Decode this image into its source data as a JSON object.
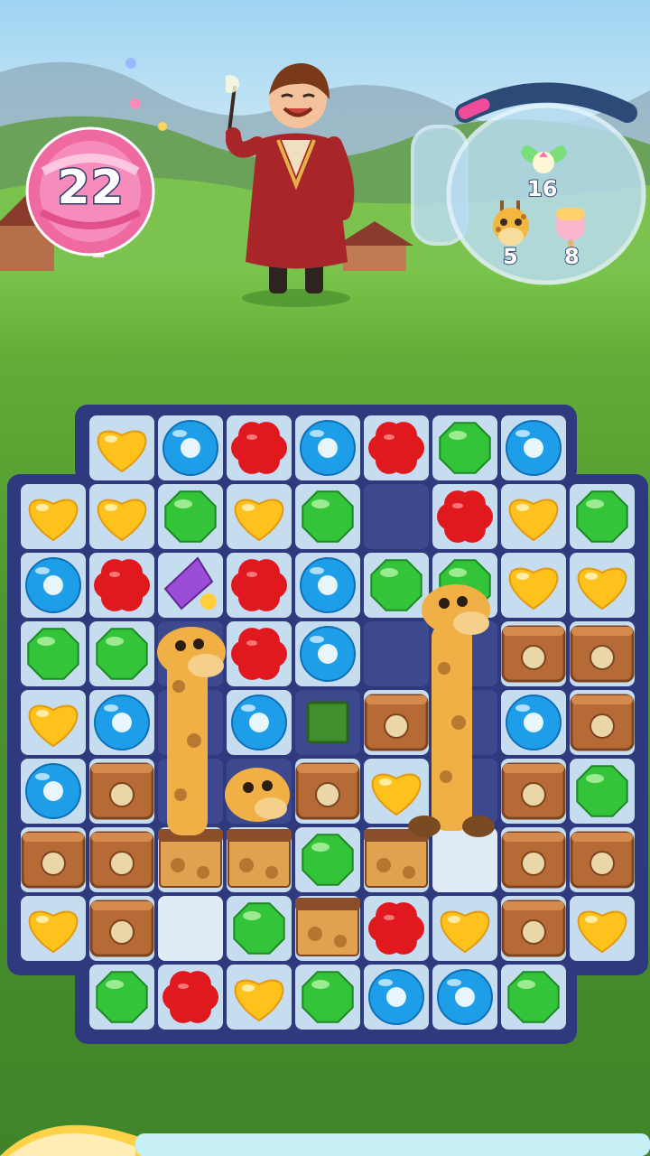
{
  "hud": {
    "moves_left": "22",
    "goals": [
      {
        "icon": "fairy-icon",
        "count": "16"
      },
      {
        "icon": "giraffe-icon",
        "count": "5"
      },
      {
        "icon": "popsicle-icon",
        "count": "8"
      }
    ],
    "progress": 0.12
  },
  "colors": {
    "red": "#e0191f",
    "blue": "#1e9ee8",
    "green": "#33c43a",
    "yellow": "#ffc21d",
    "board": "#2e3a7d",
    "crate": "#b66b36",
    "cellLight": "#cfe6f6"
  },
  "board": {
    "rows": [
      [
        "void",
        "void",
        "yellow-heart",
        "blue-ring",
        "red-flower",
        "blue-ring",
        "red-flower",
        "green-gem",
        "blue-ring",
        "void"
      ],
      [
        "void",
        "yellow-heart",
        "yellow-heart",
        "green-gem",
        "yellow-heart",
        "green-gem",
        "empty",
        "red-flower",
        "yellow-heart",
        "green-gem"
      ],
      [
        "void",
        "blue-ring",
        "red-flower",
        "rocket",
        "red-flower",
        "blue-ring",
        "green-gem",
        "green-gem",
        "yellow-heart",
        "yellow-heart"
      ],
      [
        "void",
        "green-gem",
        "green-gem",
        "empty",
        "red-flower",
        "blue-ring",
        "empty",
        "empty",
        "crate",
        "crate"
      ],
      [
        "void",
        "yellow-heart",
        "blue-ring",
        "empty",
        "blue-ring",
        "green-block",
        "crate",
        "empty",
        "blue-ring",
        "crate"
      ],
      [
        "void",
        "blue-ring",
        "crate",
        "empty",
        "empty",
        "crate",
        "yellow-heart",
        "empty",
        "crate",
        "green-gem"
      ],
      [
        "void",
        "crate",
        "crate",
        "box",
        "box",
        "green-gem",
        "box",
        "ice",
        "crate",
        "crate"
      ],
      [
        "void",
        "yellow-heart",
        "crate",
        "ice",
        "green-gem",
        "box",
        "red-flower",
        "yellow-heart",
        "crate",
        "yellow-heart"
      ],
      [
        "void",
        "void",
        "green-gem",
        "red-flower",
        "yellow-heart",
        "green-gem",
        "blue-ring",
        "blue-ring",
        "green-gem",
        "void"
      ]
    ]
  }
}
